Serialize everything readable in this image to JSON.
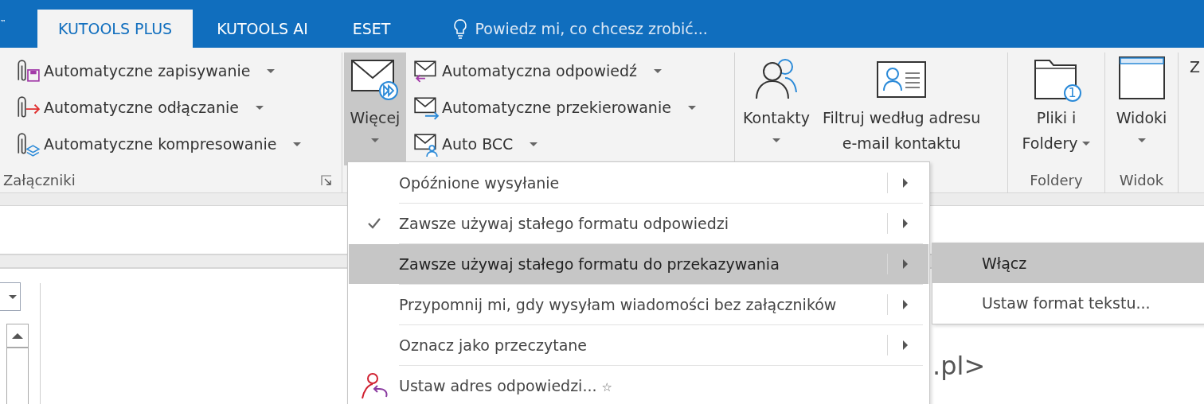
{
  "tab_bar": {
    "edge_text": "™",
    "tabs": [
      {
        "label": "KUTOOLS PLUS",
        "selected": true
      },
      {
        "label": "KUTOOLS AI",
        "selected": false
      },
      {
        "label": "ESET",
        "selected": false
      }
    ],
    "tell_me": {
      "placeholder": "Powiedz mi, co chcesz zrobić..."
    }
  },
  "ribbon": {
    "groups": [
      {
        "label": "Załączniki",
        "dialog_launcher": true,
        "items": [
          {
            "kind": "small",
            "label": "Automatyczne zapisywanie",
            "dropdown": true
          },
          {
            "kind": "small",
            "label": "Automatyczne odłączanie",
            "dropdown": true
          },
          {
            "kind": "small",
            "label": "Automatyczne kompresowanie",
            "dropdown": true
          }
        ]
      },
      {
        "items": [
          {
            "kind": "large",
            "lines": [
              "Więcej"
            ],
            "dropdown": true,
            "pressed": true
          },
          {
            "kind": "small",
            "label": "Automatyczna odpowiedź",
            "dropdown": true
          },
          {
            "kind": "small",
            "label": "Automatyczne przekierowanie",
            "dropdown": true
          },
          {
            "kind": "small",
            "label": "Auto BCC",
            "dropdown": true
          }
        ]
      },
      {
        "items": [
          {
            "kind": "large",
            "lines": [
              "Kontakty"
            ],
            "dropdown": true,
            "pressed": false
          },
          {
            "kind": "large",
            "lines": [
              "Filtruj według adresu",
              "e-mail kontaktu"
            ],
            "dropdown": false,
            "pressed": false
          }
        ]
      },
      {
        "label": "Foldery",
        "items": [
          {
            "kind": "large",
            "lines": [
              "Pliki i",
              "Foldery"
            ],
            "dropdown": true,
            "pressed": false,
            "badge": "1"
          }
        ]
      },
      {
        "label": "Widok",
        "items": [
          {
            "kind": "large",
            "lines": [
              "Widoki"
            ],
            "dropdown": true,
            "pressed": false
          }
        ]
      },
      {
        "items": [
          {
            "kind": "large",
            "lines": [
              "Z"
            ],
            "dropdown": false,
            "pressed": false
          }
        ]
      }
    ]
  },
  "more_menu": {
    "items": [
      {
        "label": "Opóźnione wysyłanie",
        "checked": false,
        "selected": false,
        "submenu": true
      },
      {
        "label": "Zawsze używaj stałego formatu odpowiedzi",
        "checked": true,
        "selected": false,
        "submenu": true
      },
      {
        "label": "Zawsze używaj stałego formatu do przekazywania",
        "checked": false,
        "selected": true,
        "submenu": true
      },
      {
        "label": "Przypomnij mi, gdy wysyłam wiadomości bez załączników",
        "checked": false,
        "selected": false,
        "submenu": true
      },
      {
        "label": "Oznacz jako przeczytane",
        "checked": false,
        "selected": false,
        "submenu": true
      },
      {
        "kind": "contact",
        "label": "Ustaw adres odpowiedzi...",
        "badge": "☆",
        "checked": false,
        "selected": false,
        "submenu": false
      }
    ]
  },
  "submenu": {
    "items": [
      {
        "label": "Włącz",
        "selected": true
      },
      {
        "label": "Ustaw format tekstu...",
        "selected": false
      }
    ]
  },
  "reading_pane": {
    "text": ".pl>"
  }
}
